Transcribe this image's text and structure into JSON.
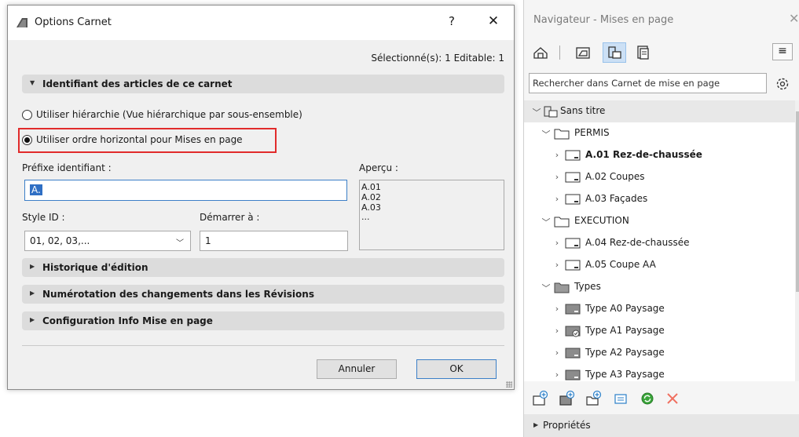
{
  "dialog": {
    "title": "Options Carnet",
    "help": "?",
    "close": "✕",
    "selection_info": "Sélectionné(s): 1 Editable: 1",
    "section_id_header": "Identifiant des articles de ce carnet",
    "radio_hierarchy": "Utiliser hiérarchie (Vue hiérarchique par sous-ensemble)",
    "radio_horizontal": "Utiliser ordre horizontal pour Mises en page",
    "prefix_label": "Préfixe identifiant :",
    "prefix_value": "A.",
    "preview_label": "Aperçu :",
    "preview_lines": [
      "A.01",
      "A.02",
      "A.03",
      "..."
    ],
    "style_id_label": "Style ID :",
    "style_id_value": "01, 02, 03,...",
    "start_label": "Démarrer à :",
    "start_value": "1",
    "section_history": "Historique d'édition",
    "section_numbering": "Numérotation des changements dans les Révisions",
    "section_config": "Configuration Info Mise en page",
    "cancel_label": "Annuler",
    "ok_label": "OK",
    "highlight_color": "#e12b2b"
  },
  "navigator": {
    "title": "Navigateur - Mises en page",
    "close": "✕",
    "menu": "≡",
    "search_placeholder": "Rechercher dans Carnet de mise en page",
    "tree": {
      "root": "Sans titre",
      "folder_permis": "PERMIS",
      "permis_items": [
        "A.01 Rez-de-chaussée",
        "A.02 Coupes",
        "A.03 Façades"
      ],
      "folder_execution": "EXECUTION",
      "execution_items": [
        "A.04 Rez-de-chaussée",
        "A.05 Coupe AA"
      ],
      "folder_types": "Types",
      "type_items": [
        "Type A0 Paysage",
        "Type A1 Paysage",
        "Type A2 Paysage",
        "Type A3 Paysage"
      ]
    },
    "properties_label": "Propriétés"
  }
}
